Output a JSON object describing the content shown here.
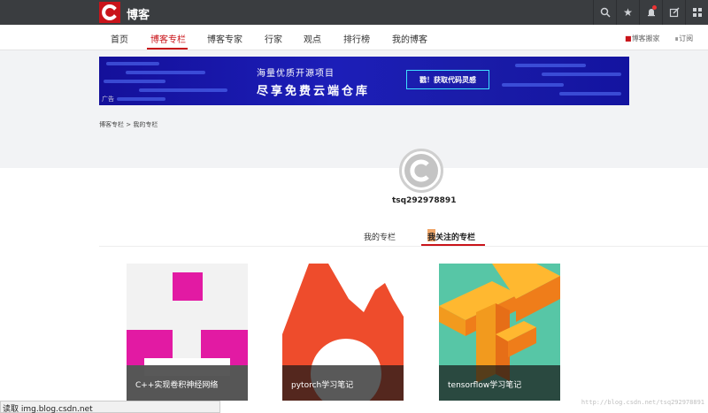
{
  "header": {
    "logo_letter": "C",
    "title": "博客",
    "icons": [
      "search-icon",
      "star-icon",
      "bell-icon",
      "edit-icon",
      "grid-icon"
    ]
  },
  "nav": {
    "items": [
      "首页",
      "博客专栏",
      "博客专家",
      "行家",
      "观点",
      "排行榜",
      "我的博客"
    ],
    "active_index": 1,
    "right_links": [
      "博客搬家",
      "订阅"
    ]
  },
  "banner": {
    "line1": "海量优质开源项目",
    "line2": "尽享免费云端仓库",
    "button": "戳！获取代码灵感",
    "ad_label": "广告"
  },
  "breadcrumb": "博客专栏 > 我的专栏",
  "profile": {
    "username": "tsq292978891"
  },
  "tabs": {
    "my_columns": "我的专栏",
    "followed_columns": "关注的专栏",
    "followed_prefix": "我",
    "active": "followed_columns"
  },
  "columns": [
    {
      "title": "C++实现卷积神经网络"
    },
    {
      "title": "pytorch学习笔记"
    },
    {
      "title": "tensorflow学习笔记"
    }
  ],
  "status_bar": "读取 img.blog.csdn.net",
  "watermark": "http://blog.csdn.net/tsq292978891",
  "colors": {
    "brand_red": "#c9141a",
    "topbar": "#3a3d40",
    "banner_blue": "#1a1ca8"
  }
}
